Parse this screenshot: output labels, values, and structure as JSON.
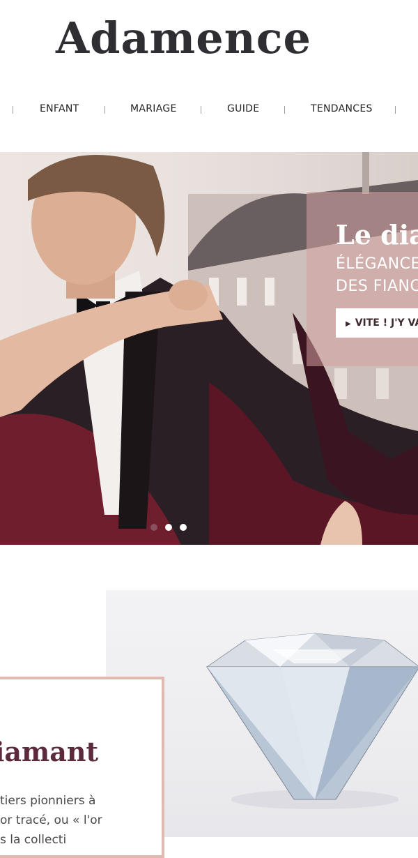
{
  "brand": {
    "name": "Adamence"
  },
  "nav": {
    "items": [
      "ENFANT",
      "MARIAGE",
      "GUIDE",
      "TENDANCES"
    ]
  },
  "hero": {
    "title": "Le diam",
    "subtitle_line1": "ÉLÉGANCE",
    "subtitle_line2": "DES FIANC",
    "cta_label": "VITE ! J'Y VA",
    "cta_icon": "play-triangle-icon",
    "slide_count": 3,
    "active_slide": 1
  },
  "feature": {
    "title": "iamant",
    "text_line1": "tiers pionniers à",
    "text_line2": "or tracé, ou « l'or",
    "text_line3": "s la collecti"
  },
  "colors": {
    "brand_text": "#2f2f33",
    "accent": "#5b2a3c",
    "card_border": "#e2b9b0",
    "hero_box": "#d2a0a0"
  }
}
